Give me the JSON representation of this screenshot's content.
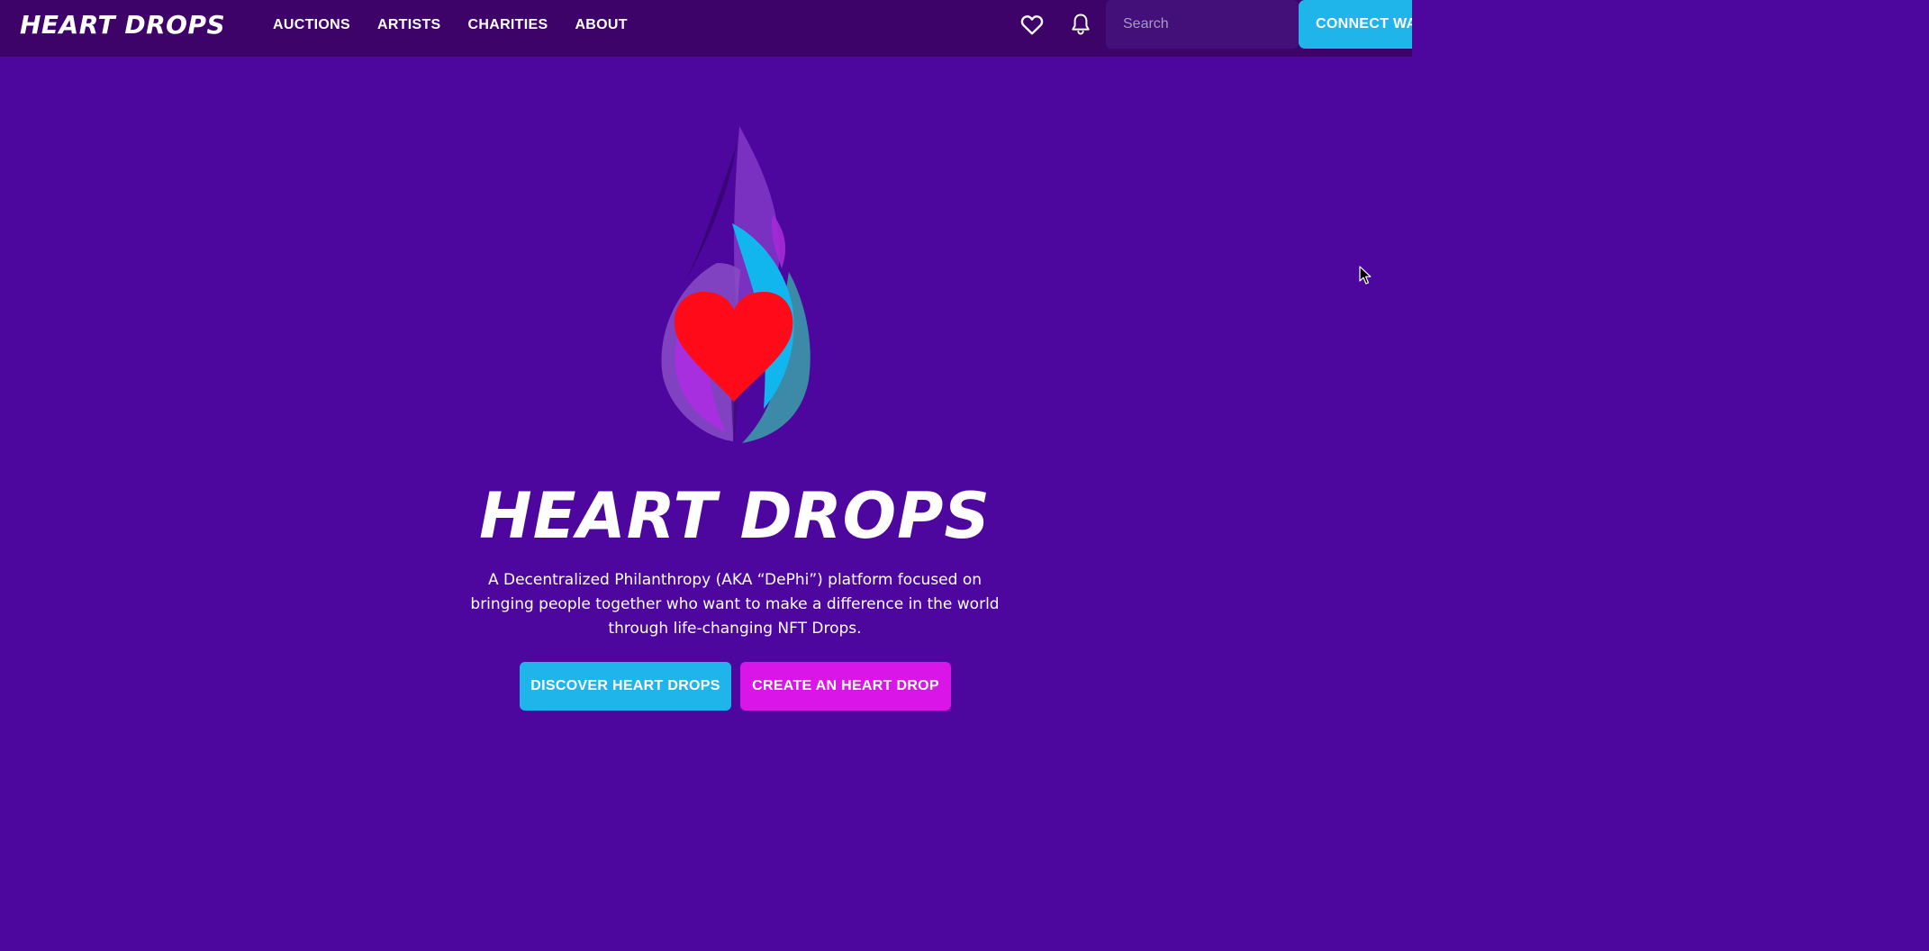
{
  "nav": {
    "brand": "HEART DROPS",
    "links": [
      {
        "label": "AUCTIONS"
      },
      {
        "label": "ARTISTS"
      },
      {
        "label": "CHARITIES"
      },
      {
        "label": "ABOUT"
      }
    ],
    "favorites_icon": "heart-outline-icon",
    "notifications_icon": "bell-icon",
    "search": {
      "placeholder": "Search",
      "value": ""
    },
    "connect_wallet_label": "CONNECT WA"
  },
  "hero": {
    "logo_icon": "flame-heart-logo",
    "title": "HEART DROPS",
    "description": "A Decentralized Philanthropy (AKA “DePhi”) platform focused on bringing people together who want to make a difference in the world through life-changing NFT Drops.",
    "buttons": {
      "discover_label": "DISCOVER HEART DROPS",
      "create_label": "CREATE AN HEART DROP"
    }
  },
  "colors": {
    "background": "#4d079f",
    "navbar": "#3d0368",
    "accent_cyan": "#1fb5ea",
    "accent_magenta": "#d915e8",
    "heart_red": "#ff0a18"
  }
}
